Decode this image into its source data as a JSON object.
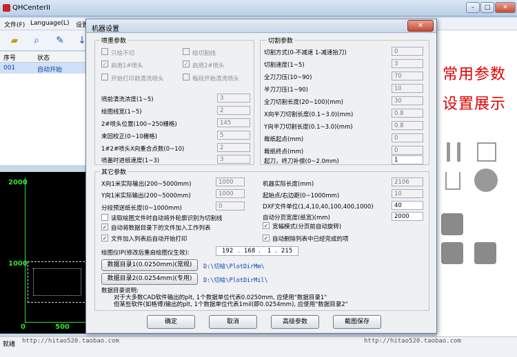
{
  "app": {
    "title": "QHCenterII"
  },
  "window_buttons": {
    "min": "–",
    "max": "□",
    "close": "✕"
  },
  "menu": [
    "文件(F)",
    "Language(L)",
    "设置"
  ],
  "list": {
    "headers": [
      "序号",
      "状态"
    ],
    "rows": [
      {
        "id": "001",
        "status": "自动开始"
      }
    ]
  },
  "preview": {
    "ticks": [
      "2000",
      "1000",
      "0",
      "500"
    ]
  },
  "right_panel": {
    "line1": "常用参数",
    "line2": "设置展示"
  },
  "status": {
    "left": "就绪",
    "watermark": "http://hitao520.taobao.com"
  },
  "dialog": {
    "title": "机器设置",
    "close_label": "✕",
    "spray": {
      "title": "喷墨参数",
      "checks": [
        {
          "label": "只绘不切",
          "checked": false
        },
        {
          "label": "绘切割线",
          "checked": false
        },
        {
          "label": "启用1#喷头",
          "checked": true
        },
        {
          "label": "启用2#喷头",
          "checked": true
        },
        {
          "label": "开始打印前清洗喷头",
          "checked": false
        },
        {
          "label": "每段开始清洗喷头",
          "checked": false
        }
      ],
      "params": [
        {
          "label": "喷前清洗浓度(1~5)",
          "value": "3"
        },
        {
          "label": "绘图线宽(1~5)",
          "value": "2"
        },
        {
          "label": "2#喷头位置(100~250栅格)",
          "value": "145"
        },
        {
          "label": "来回校正(0~10栅格)",
          "value": "5"
        },
        {
          "label": "1#2#喷头X向重合点数(0~10)",
          "value": "2"
        },
        {
          "label": "喷墨时进纸速度(1~3)",
          "value": "3"
        }
      ]
    },
    "cut": {
      "title": "切割参数",
      "params": [
        {
          "label": "切割方式(0-不减速 1-减速抬刀)",
          "value": "0",
          "enabled": false
        },
        {
          "label": "切割速度(1~5)",
          "value": "3",
          "enabled": false
        },
        {
          "label": "全刀刀压(10~90)",
          "value": "70",
          "enabled": false
        },
        {
          "label": "半刀刀压(1~90)",
          "value": "10",
          "enabled": false
        },
        {
          "label": "全刀切割长度(20~100)(mm)",
          "value": "30",
          "enabled": false
        },
        {
          "label": "X向半刀切割长度(0.1~3.0)(mm)",
          "value": "0.8",
          "enabled": false
        },
        {
          "label": "Y向半刀切割长度(0.1~3.0)(mm)",
          "value": "0.8",
          "enabled": false
        },
        {
          "label": "裁纸起点(mm)",
          "value": "0",
          "enabled": false
        },
        {
          "label": "裁纸终点(mm)",
          "value": "0",
          "enabled": false
        },
        {
          "label": "起刀，终刀补偿(0~2.0mm)",
          "value": "1",
          "enabled": true
        }
      ]
    },
    "other": {
      "title": "其它参数",
      "left_params": [
        {
          "label": "X向1米实际输出(200~5000mm)",
          "value": "1000"
        },
        {
          "label": "Y向1米实际输出(200~5000mm)",
          "value": "1000"
        },
        {
          "label": "分段预送纸长度(0~1000mm)",
          "value": "0"
        }
      ],
      "right_params": [
        {
          "label": "机器实际长度(mm)",
          "value": "2106",
          "enabled": false
        },
        {
          "label": "起始点/右边距(0~1000mm)",
          "value": "10",
          "enabled": false
        },
        {
          "label": "DXF文件单位(1,4,10,40,100,400,1000)",
          "value": "40",
          "enabled": true
        },
        {
          "label": "自动分页宽度(纸宽)(mm)",
          "value": "2000",
          "enabled": true
        }
      ],
      "left_checks": [
        {
          "label": "读取绘图文件时自动将外轮廓识别为切割线",
          "checked": false
        },
        {
          "label": "自动将数据目录下的文件加入工作列表",
          "checked": true
        },
        {
          "label": "文件加入列表后自动开始打印",
          "checked": true
        }
      ],
      "right_checks": [
        {
          "label": "宽幅模式(分页前自动旋转)",
          "checked": true
        },
        {
          "label": "自动删除列表中已经完成的项",
          "checked": true
        }
      ],
      "ip": {
        "label": "绘图仪IP(修改后重启绘图仪生效):",
        "octets": [
          "192",
          "168",
          "1",
          "215"
        ]
      },
      "dirs": [
        {
          "button": "数据目录1(0.0250mm)(常规)",
          "path": "D:\\切绘\\PlotDirMm\\"
        },
        {
          "button": "数据目录2(0.0254mm)(专用)",
          "path": "D:\\切绘\\PlotDirMil\\"
        }
      ],
      "note_title": "数据目录说明:",
      "note_lines": [
        "对于大多数CAD软件输出的plt, 1个数据单位代表0.0250mm, 应使用\"数据目录1\"",
        "但某些软件(如格博)输出的plt, 1个数据单位代表1mil(即0.0254mm), 应使用\"数据目录2\""
      ]
    },
    "buttons": {
      "ok": "确定",
      "cancel": "取消",
      "advanced": "高级参数",
      "screenshot": "截图保存"
    }
  }
}
